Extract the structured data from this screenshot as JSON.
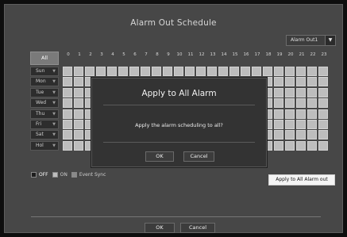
{
  "window": {
    "title": "Alarm Out Schedule"
  },
  "alarm_select": {
    "value": "Alarm Out1",
    "caret_icon": "▼"
  },
  "grid": {
    "all_label": "All",
    "hours": [
      "0",
      "1",
      "2",
      "3",
      "4",
      "5",
      "6",
      "7",
      "8",
      "9",
      "10",
      "11",
      "12",
      "13",
      "14",
      "15",
      "16",
      "17",
      "18",
      "19",
      "20",
      "21",
      "22",
      "23"
    ],
    "days": [
      "Sun",
      "Mon",
      "Tue",
      "Wed",
      "Thu",
      "Fri",
      "Sat",
      "Hol"
    ],
    "day_caret_icon": "▼"
  },
  "legend": {
    "off": "OFF",
    "on": "ON",
    "event_sync": "Event Sync"
  },
  "apply_all_button": "Apply to All Alarm out",
  "footer": {
    "ok": "OK",
    "cancel": "Cancel"
  },
  "modal": {
    "title": "Apply to All Alarm",
    "message": "Apply the alarm scheduling to all?",
    "ok": "OK",
    "cancel": "Cancel"
  },
  "colors": {
    "window_bg": "#474747",
    "cell_on": "#bdbdbd",
    "legend_off": "#1e1e1e",
    "legend_on": "#bdbdbd",
    "legend_event_sync": "#8a8a8a"
  }
}
